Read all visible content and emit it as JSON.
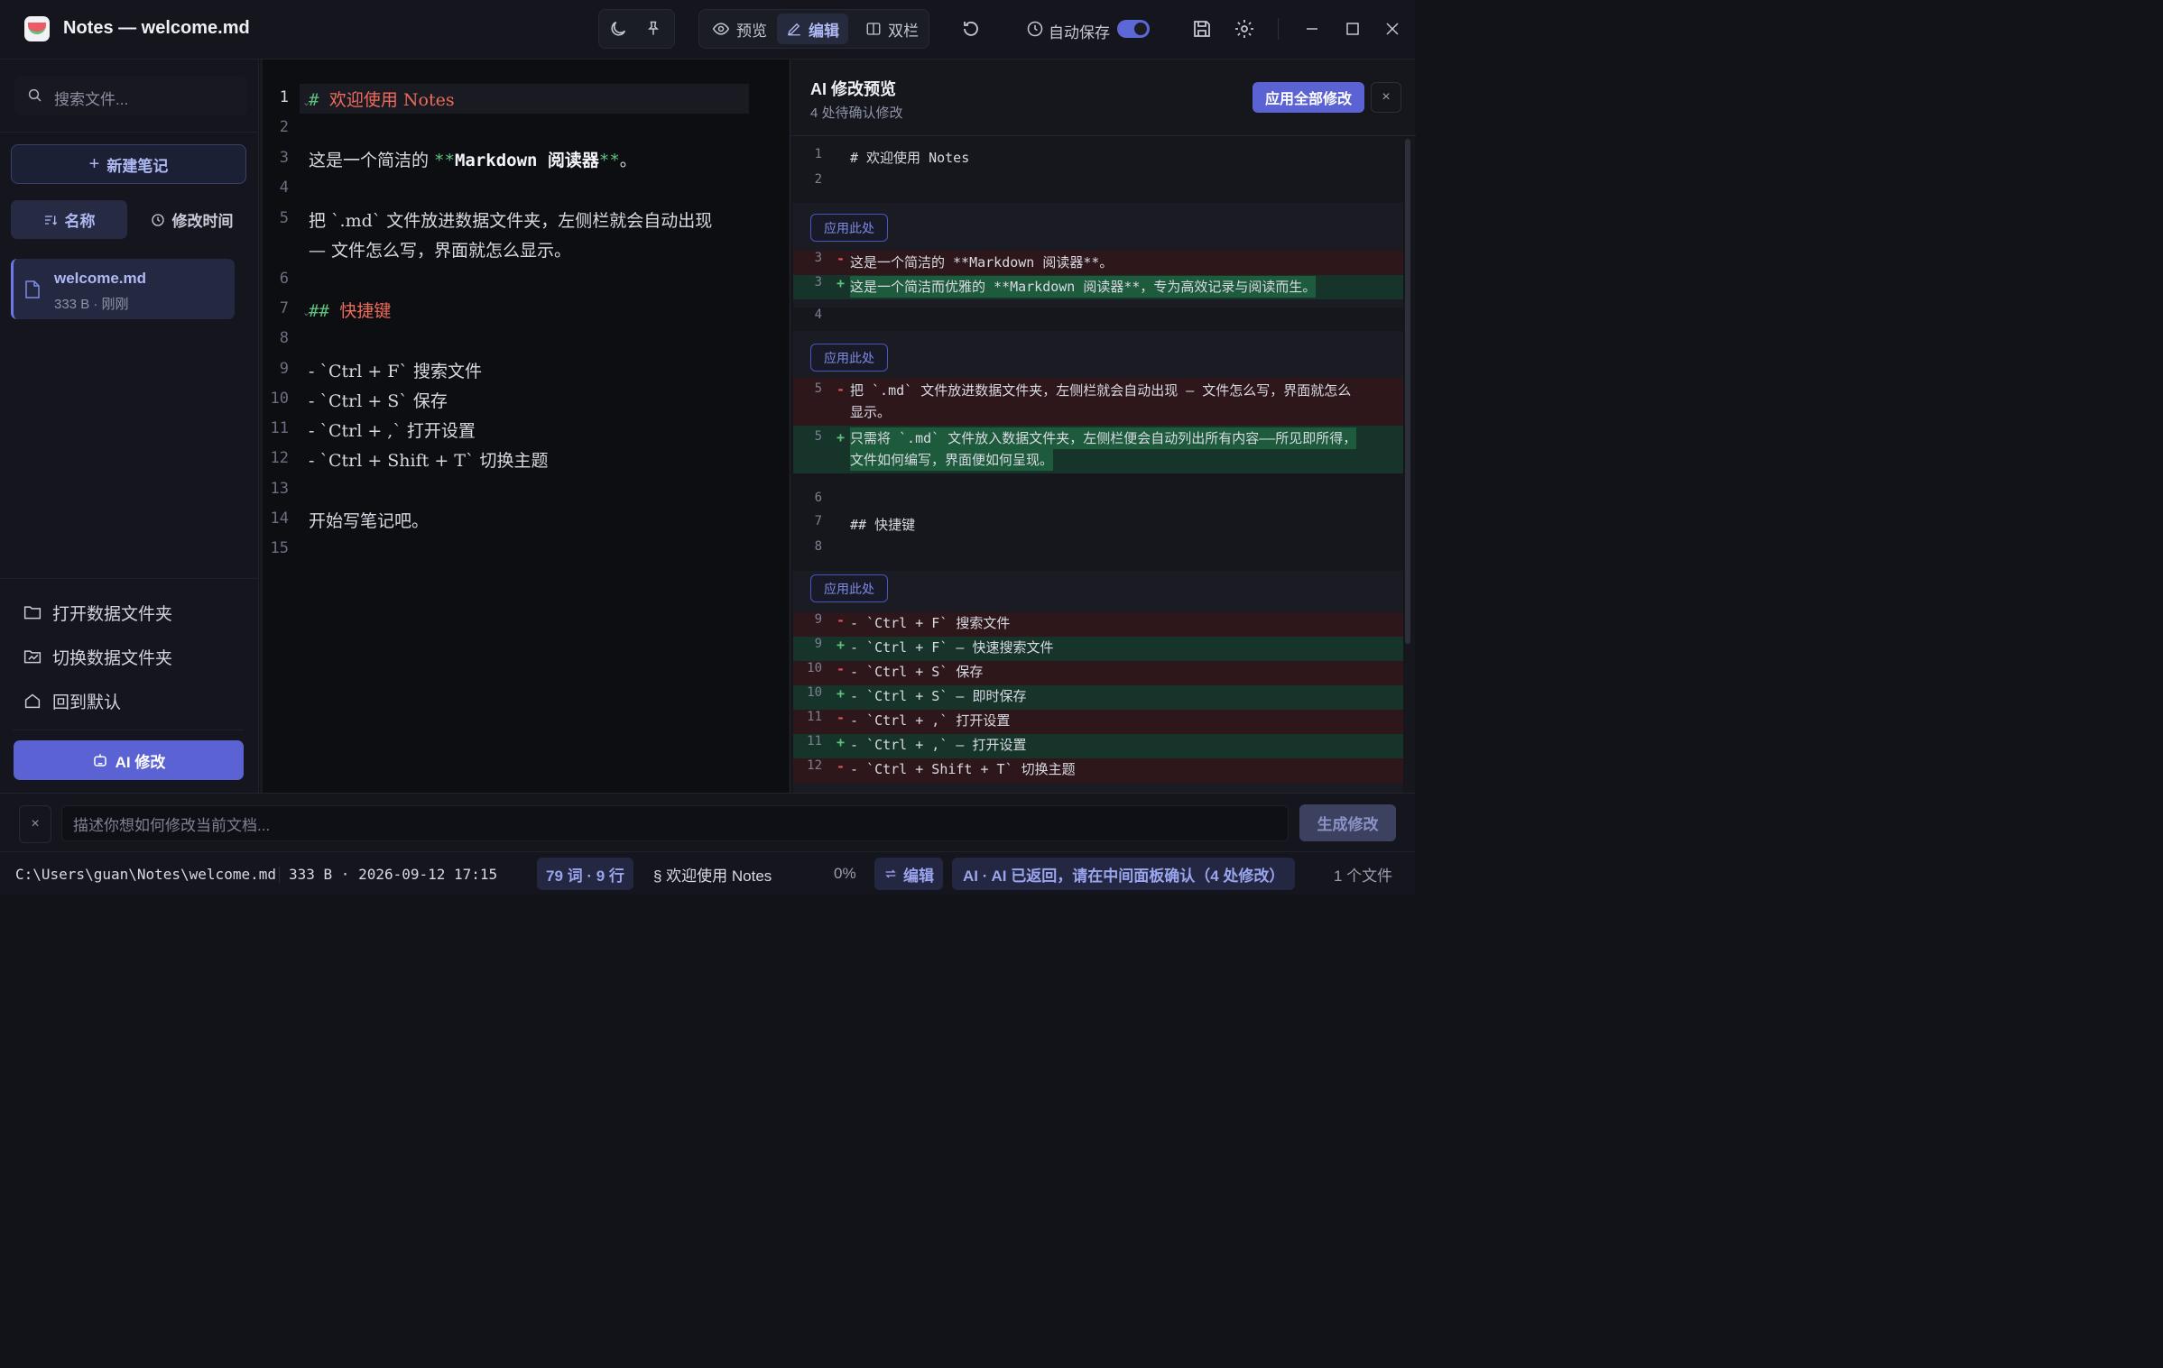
{
  "window": {
    "title": "Notes — welcome.md",
    "theme_icon": "moon-icon",
    "pin_icon": "pin-icon"
  },
  "toolbar": {
    "preview_label": "预览",
    "edit_label": "编辑",
    "split_label": "双栏",
    "autosave_label": "自动保存",
    "autosave_on": true
  },
  "sidebar": {
    "search_placeholder": "搜索文件...",
    "new_note_label": "新建笔记",
    "sort_name_label": "名称",
    "sort_time_label": "修改时间",
    "files": [
      {
        "name": "welcome.md",
        "meta": "333 B · 刚刚"
      }
    ],
    "links": {
      "open_folder": "打开数据文件夹",
      "switch_folder": "切换数据文件夹",
      "reset_default": "回到默认"
    },
    "ai_button_label": "AI 修改"
  },
  "editor": {
    "line_numbers": [
      "1",
      "2",
      "3",
      "4",
      "5",
      "",
      "6",
      "7",
      "8",
      "9",
      "10",
      "11",
      "12",
      "13",
      "14",
      "15"
    ],
    "lines": {
      "l1_mark": "# ",
      "l1_text": "欢迎使用 Notes",
      "l3_a": "这是一个简洁的 ",
      "l3_mark1": "**",
      "l3_bold": "Markdown 阅读器",
      "l3_mark2": "**",
      "l3_b": "。",
      "l5_a": "把 `.md` 文件放进数据文件夹，左侧栏就会自动出现",
      "l5_b": "— 文件怎么写，界面就怎么显示。",
      "l7_mark": "## ",
      "l7_text": "快捷键",
      "l9": "- `Ctrl + F` 搜索文件",
      "l10": "- `Ctrl + S` 保存",
      "l11": "- `Ctrl + ,` 打开设置",
      "l12": "- `Ctrl + Shift + T` 切换主题",
      "l14": "开始写笔记吧。"
    }
  },
  "ai_panel": {
    "title": "AI 修改预览",
    "subtitle": "4 处待确认修改",
    "apply_all_label": "应用全部修改",
    "close_label": "×",
    "apply_here_label": "应用此处",
    "context1": [
      {
        "n": "1",
        "t": "# 欢迎使用 Notes"
      },
      {
        "n": "2",
        "t": ""
      }
    ],
    "hunk1": [
      {
        "n": "3",
        "s": "-",
        "t": "这是一个简洁的 **Markdown 阅读器**。"
      },
      {
        "n": "3",
        "s": "+",
        "t": "这是一个简洁而优雅的 **Markdown 阅读器**，专为高效记录与阅读而生。"
      }
    ],
    "context2": [
      {
        "n": "4",
        "t": ""
      }
    ],
    "hunk2_del": {
      "n": "5",
      "s": "-",
      "t1": "把 `.md` 文件放进数据文件夹，左侧栏就会自动出现 — 文件怎么写，界面就怎么",
      "t2": "显示。"
    },
    "hunk2_add": {
      "n": "5",
      "s": "+",
      "t1": "只需将 `.md` 文件放入数据文件夹，左侧栏便会自动列出所有内容——所见即所得，",
      "t2": "文件如何编写，界面便如何呈现。"
    },
    "context3": [
      {
        "n": "6",
        "t": ""
      },
      {
        "n": "7",
        "t": "## 快捷键"
      },
      {
        "n": "8",
        "t": ""
      }
    ],
    "hunk3": [
      {
        "n": "9",
        "s": "-",
        "t": "- `Ctrl + F` 搜索文件"
      },
      {
        "n": "9",
        "s": "+",
        "t": "- `Ctrl + F` — 快速搜索文件"
      },
      {
        "n": "10",
        "s": "-",
        "t": "- `Ctrl + S` 保存"
      },
      {
        "n": "10",
        "s": "+",
        "t": "- `Ctrl + S` — 即时保存"
      },
      {
        "n": "11",
        "s": "-",
        "t": "- `Ctrl + ,` 打开设置"
      },
      {
        "n": "11",
        "s": "+",
        "t": "- `Ctrl + ,` — 打开设置"
      },
      {
        "n": "12",
        "s": "-",
        "t": "- `Ctrl + Shift + T` 切换主题"
      }
    ]
  },
  "prompt": {
    "close_label": "×",
    "placeholder": "描述你想如何修改当前文档...",
    "generate_label": "生成修改"
  },
  "status": {
    "path": "C:\\Users\\guan\\Notes\\welcome.md",
    "info": "333 B · 2026-09-12 17:15",
    "words": "79 词 · 9 行",
    "section": "§ 欢迎使用 Notes",
    "scroll": "0%",
    "mode": "编辑",
    "ai_status": "AI · AI 已返回，请在中间面板确认（4 处修改）",
    "file_count": "1 个文件"
  },
  "colors": {
    "accent": "#5b63d4",
    "heading": "#ef6b5b",
    "added": "#5fc27c",
    "removed": "#e0525c"
  }
}
